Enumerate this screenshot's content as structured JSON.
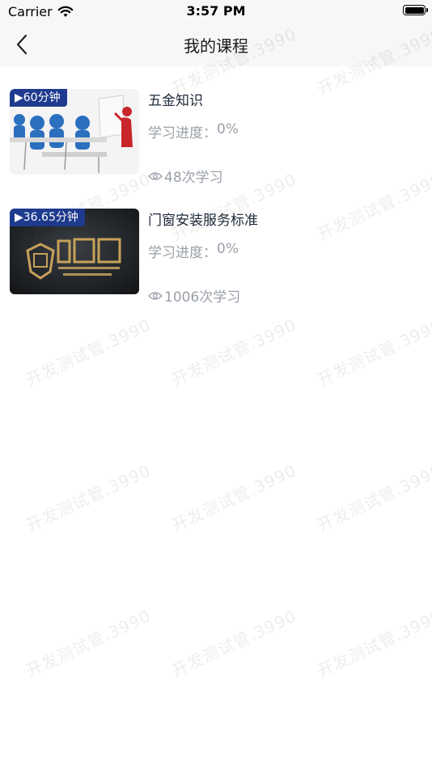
{
  "status_bar": {
    "carrier": "Carrier",
    "time": "3:57 PM"
  },
  "nav": {
    "title": "我的课程"
  },
  "courses": [
    {
      "title": "五金知识",
      "duration": "▶60分钟",
      "progress_label": "学习进度：",
      "progress_value": "0%",
      "views": "48次学习"
    },
    {
      "title": "门窗安装服务标准",
      "duration": "▶36.65分钟",
      "progress_label": "学习进度：",
      "progress_value": "0%",
      "views": "1006次学习"
    }
  ],
  "watermark": "开发测试管.3990",
  "icons": {
    "back": "chevron-left-icon",
    "wifi": "wifi-icon",
    "battery": "battery-icon",
    "eye": "eye-icon"
  }
}
